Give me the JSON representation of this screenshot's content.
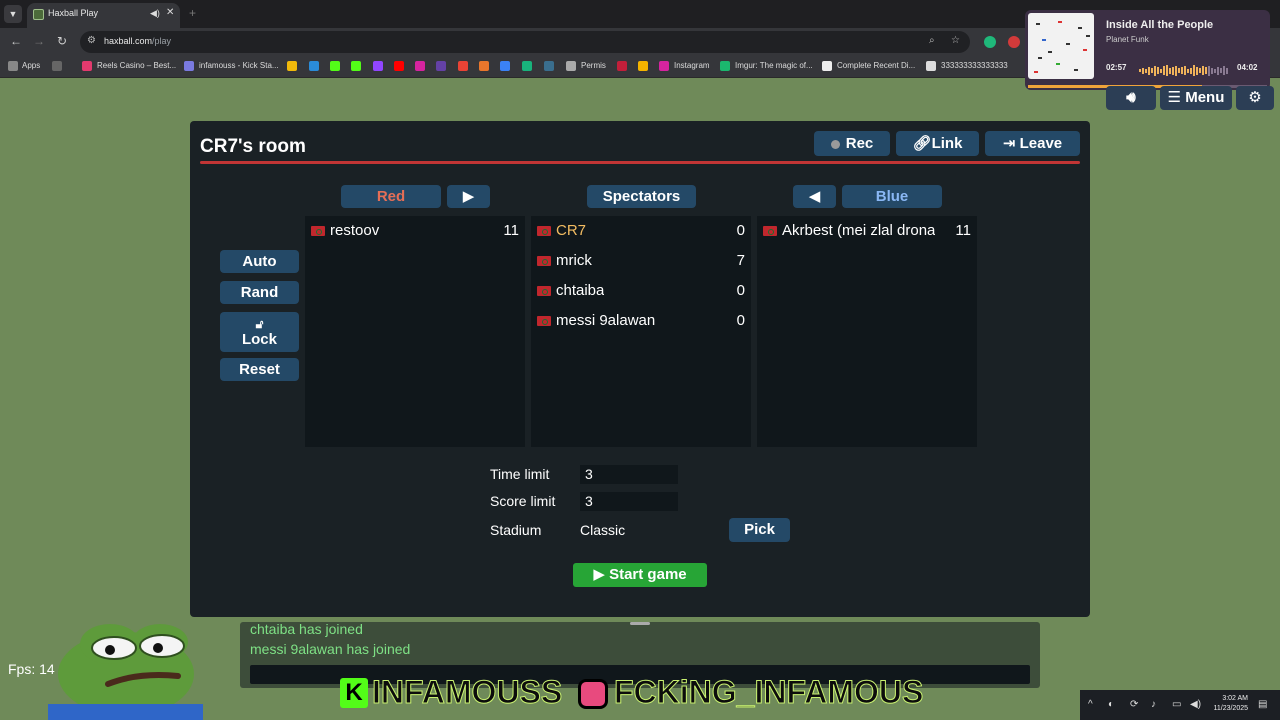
{
  "browser": {
    "tab_title": "Haxball Play",
    "url_host": "haxball.com",
    "url_path": "/play",
    "bookmarks": [
      "Apps",
      "Reels Casino – Best...",
      "infamouss - Kick Sta...",
      "Permis",
      "Instagram",
      "Imgur: The magic of...",
      "Complete Recent Di...",
      "333333333333333"
    ]
  },
  "media": {
    "title": "Inside All the People",
    "artist": "Planet Funk",
    "elapsed": "02:57",
    "duration": "04:02",
    "progress": 0.73
  },
  "hx_top": {
    "menu_label": "Menu"
  },
  "room": {
    "title": "CR7's room",
    "rec_label": "Rec",
    "link_label": "Link",
    "leave_label": "Leave",
    "red_label": "Red",
    "spectators_label": "Spectators",
    "blue_label": "Blue",
    "red_players": [
      {
        "name": "restoov",
        "score": "11"
      }
    ],
    "spectators": [
      {
        "name": "CR7",
        "score": "0"
      },
      {
        "name": "mrick",
        "score": "7"
      },
      {
        "name": "chtaiba",
        "score": "0"
      },
      {
        "name": "messi 9alawan",
        "score": "0"
      }
    ],
    "blue_players": [
      {
        "name": "Akrbest (mei zlal drona",
        "score": "11"
      }
    ],
    "auto_label": "Auto",
    "rand_label": "Rand",
    "lock_label": "Lock",
    "reset_label": "Reset",
    "time_limit_label": "Time limit",
    "time_limit_value": "3",
    "score_limit_label": "Score limit",
    "score_limit_value": "3",
    "stadium_label": "Stadium",
    "stadium_value": "Classic",
    "pick_label": "Pick",
    "start_label": "Start game"
  },
  "chat": {
    "messages": [
      "chtaiba has joined",
      "messi 9alawan has joined"
    ]
  },
  "fps": "Fps: 14",
  "overlay": {
    "kick_name": "INFAMOUSS",
    "insta_name": "FCKiNG_INFAMOUS"
  },
  "taskbar": {
    "time": "3:02 AM",
    "date": "11/23/2025"
  },
  "colors": {
    "dialog_bg": "#1a2125",
    "button_bg": "#244967",
    "red_team": "#e56e56",
    "blue_team": "#8ab7f4",
    "host_name": "#f2bc62",
    "start_green": "#27a536",
    "chat_green": "#7ee085"
  }
}
